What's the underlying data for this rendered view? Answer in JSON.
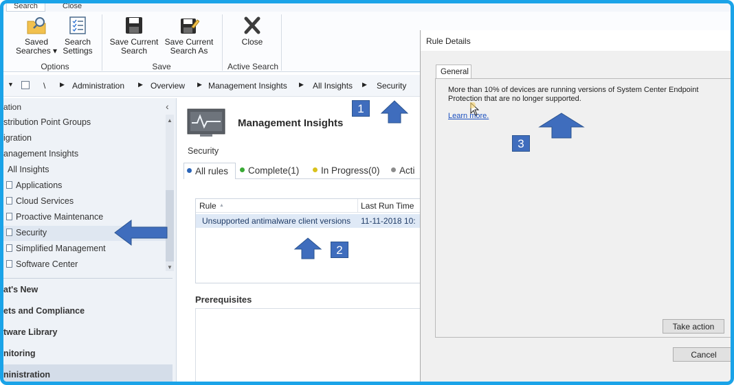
{
  "ribbon": {
    "tabs": [
      "Search",
      "Close"
    ],
    "buttons": {
      "saved_searches": "Saved\nSearches ▾",
      "search_settings": "Search\nSettings",
      "save_current_search": "Save Current\nSearch",
      "save_current_search_as": "Save Current\nSearch As",
      "close": "Close"
    },
    "groups": {
      "options": "Options",
      "save": "Save",
      "active_search": "Active Search"
    }
  },
  "breadcrumb": {
    "root": "\\",
    "items": [
      "Administration",
      "Overview",
      "Management Insights",
      "All Insights",
      "Security"
    ]
  },
  "nav": {
    "header": "ation",
    "collapse_glyph": "‹",
    "items": [
      "stribution Point Groups",
      "igration",
      "anagement Insights",
      "All Insights",
      "Applications",
      "Cloud Services",
      "Proactive Maintenance",
      "Security",
      "Simplified Management",
      "Software Center"
    ],
    "selected": "Security",
    "wunderbar": [
      "at's New",
      "ets and Compliance",
      "tware Library",
      "nitoring",
      "ninistration"
    ]
  },
  "main": {
    "title": "Management Insights",
    "subtitle": "Security",
    "tabs": [
      {
        "label": "All rules",
        "color": "#2a64b8"
      },
      {
        "label": "Complete(1)",
        "color": "#3aaa35"
      },
      {
        "label": "In Progress(0)",
        "color": "#d9c21c"
      },
      {
        "label": "Acti",
        "color": "#8c8c8c"
      }
    ],
    "grid": {
      "columns": [
        "Rule",
        "Last Run Time"
      ],
      "sort_glyph": "▲",
      "rows": [
        [
          "Unsupported antimalware client versions",
          "11-11-2018 10:"
        ]
      ]
    },
    "prerequisites": "Prerequisites"
  },
  "dialog": {
    "title": "Rule Details",
    "tab": "General",
    "text": "More than 10% of devices are running versions of System Center Endpoint Protection that are no longer supported.",
    "link": "Learn more.",
    "take_action": "Take action",
    "cancel": "Cancel"
  },
  "annotations": [
    "1",
    "2",
    "3"
  ],
  "colors": {
    "frame": "#1aa3e8",
    "arrow": "#3f6dbd"
  }
}
